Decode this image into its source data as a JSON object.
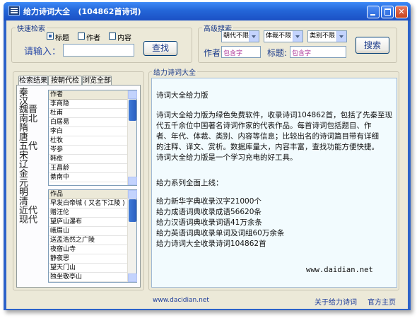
{
  "window": {
    "title": "给力诗词大全   (104862首诗词)"
  },
  "quick_search": {
    "group_label": "快速检索",
    "options": [
      {
        "label": "标题",
        "checked": true
      },
      {
        "label": "作者",
        "checked": false
      },
      {
        "label": "内容",
        "checked": false
      }
    ],
    "input_label": "请输入：",
    "input_value": "",
    "button_label": "查找"
  },
  "advanced_search": {
    "group_label": "高级搜索",
    "dropdowns": [
      "朝代不限",
      "体裁不限",
      "类别不限"
    ],
    "author_label": "作者:",
    "author_placeholder": "包含字",
    "title_label": "标题:",
    "title_placeholder": "包含字",
    "button_label": "搜索"
  },
  "tabs": [
    "检索结果",
    "按朝代检索",
    "浏览全部"
  ],
  "dynasties": [
    {
      "text": "秦"
    },
    {
      "text": "汉"
    },
    {
      "text": "魏晋"
    },
    {
      "text": "南北"
    },
    {
      "text": "隋"
    },
    {
      "text": "唐"
    },
    {
      "text": "五代"
    },
    {
      "text": "宋"
    },
    {
      "text": "辽"
    },
    {
      "text": "金"
    },
    {
      "text": "元"
    },
    {
      "text": "明"
    },
    {
      "text": "清"
    },
    {
      "text": "近代"
    },
    {
      "text": "现代"
    }
  ],
  "authors_list": {
    "header": "作者",
    "items": [
      "李商隐",
      "杜甫",
      "白居易",
      "李白",
      "杜牧",
      "岑参",
      "韩愈",
      "王昌龄",
      "綦南中"
    ]
  },
  "works_list": {
    "header": "作品",
    "items": [
      "早发白帝城 ( 又名下江陵 )",
      "赠汪伦",
      "望庐山瀑布",
      "峨眉山",
      "送孟浩然之广陵",
      "夜宿山寺",
      "静夜思",
      "望天门山",
      "独坐敬亭山"
    ]
  },
  "content_panel": {
    "label": "给力诗词大全",
    "heading": "诗词大全给力版",
    "paragraph_lines": [
      "诗词大全给力版为绿色免费软件，收录诗词104862首，包括了先秦至现",
      "代五千余位中国著名诗词作家的代表作品。每首诗词包括题目、作",
      "者、年代、体裁、类别、内容等信息；比较出名的诗词篇目带有详细",
      "的注释、译文、赏析。数据库量大，内容丰富，查找功能方便快捷。",
      "诗词大全给力版是一个学习充电的好工具。"
    ],
    "series_title": "给力系列全面上线：",
    "series_lines": [
      "给力新华字典收录汉字21000个",
      "给力成语词典收录成语56620条",
      "给力汉语词典收录词语41万余条",
      "给力英语词典收录单词及词组60万余条",
      "给力诗词大全收录诗词104862首"
    ],
    "website": "www.daidian.net"
  },
  "footer": {
    "website_link": "www.dacidian.net",
    "about_link": "关于给力诗词",
    "home_link": "官方主页"
  }
}
